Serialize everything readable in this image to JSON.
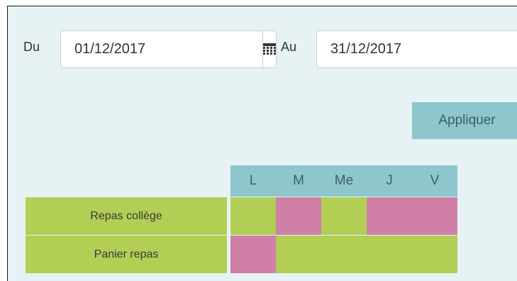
{
  "filter": {
    "from_label": "Du",
    "from_value": "01/12/2017",
    "to_label": "Au",
    "to_value": "31/12/2017",
    "calendar_icon": "calendar-icon",
    "apply_label": "Appliquer"
  },
  "schedule": {
    "days": [
      "L",
      "M",
      "Me",
      "J",
      "V"
    ],
    "rows": [
      {
        "label": "Repas collège",
        "cells": [
          "yes",
          "no",
          "yes",
          "no",
          "no"
        ]
      },
      {
        "label": "Panier repas",
        "cells": [
          "no",
          "yes",
          "yes",
          "yes",
          "yes"
        ]
      }
    ]
  },
  "colors": {
    "background": "#e6f2f4",
    "accent": "#8dc6cd",
    "active": "#b2ce55",
    "inactive": "#d07fa6"
  }
}
